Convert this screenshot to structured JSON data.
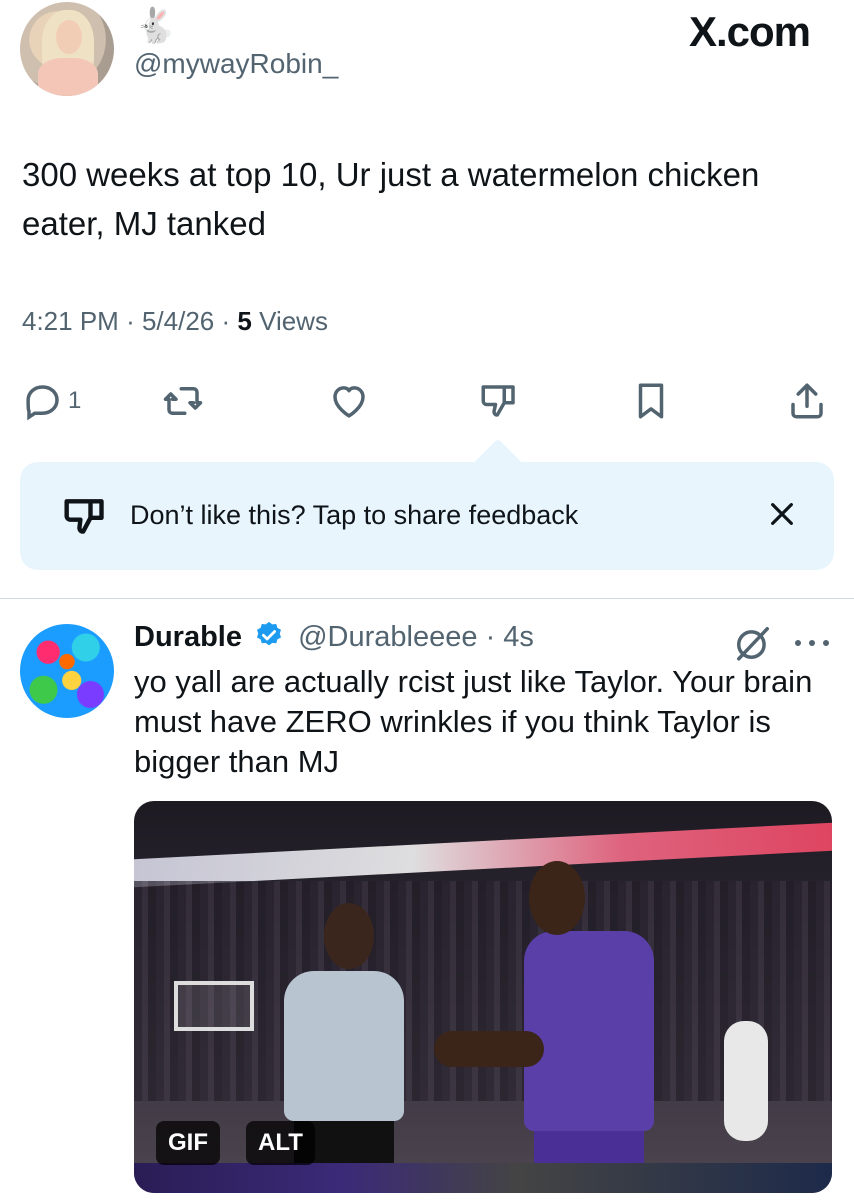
{
  "header": {
    "handle": "@mywayRobin_",
    "name_emoji": "🐇",
    "site_logo": "X.com"
  },
  "tweet": {
    "text": "300 weeks at top 10, Ur just a watermelon chicken eater, MJ tanked",
    "time": "4:21 PM",
    "date": "5/4/26",
    "views_count": "5",
    "views_label": "Views",
    "reply_count": "1"
  },
  "feedback": {
    "text": "Don’t like this? Tap to share feedback"
  },
  "reply": {
    "name": "Durable",
    "handle": "@Durableeee",
    "separator": "·",
    "age": "4s",
    "text": "yo yall are actually rcist just like Taylor. Your brain must have ZERO wrinkles if you think Taylor is bigger than MJ",
    "media_badges": {
      "gif": "GIF",
      "alt": "ALT"
    }
  },
  "icons": {
    "reply": "reply-bubble-icon",
    "repost": "repost-icon",
    "like": "heart-icon",
    "dislike": "thumbs-down-icon",
    "bookmark": "bookmark-icon",
    "share": "share-icon",
    "close": "close-icon",
    "verified": "verified-badge-icon",
    "grok": "grok-icon",
    "more": "more-icon"
  },
  "colors": {
    "text": "#0f1419",
    "secondary": "#536471",
    "accent": "#1d9bf0",
    "feedback_bg": "#e8f5fd",
    "divider": "#cfd9de"
  }
}
